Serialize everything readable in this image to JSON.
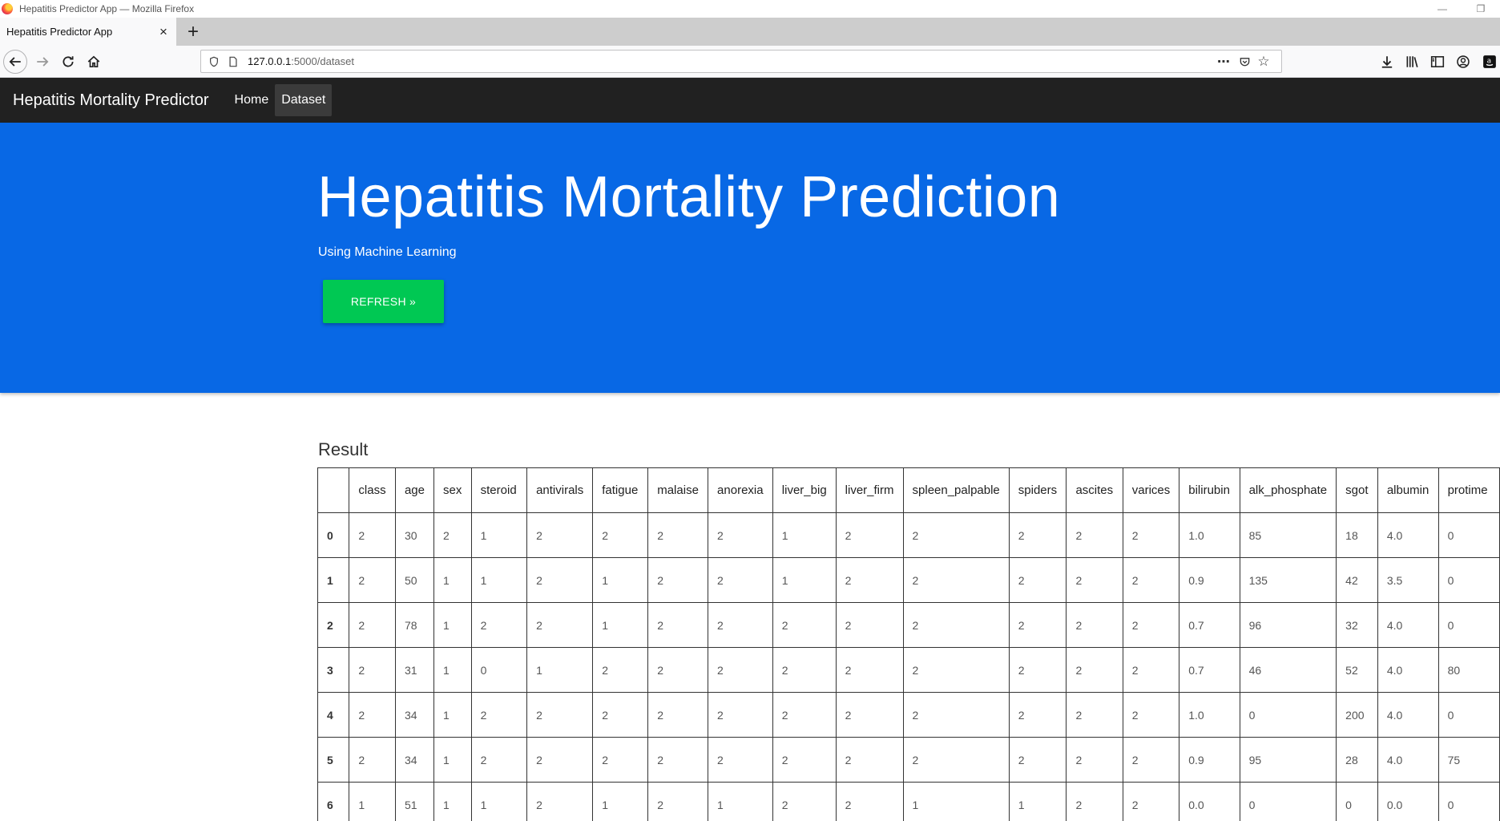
{
  "browser": {
    "window_title": "Hepatitis Predictor App — Mozilla Firefox",
    "tab_title": "Hepatitis Predictor App",
    "url_host": "127.0.0.1",
    "url_path": ":5000/dataset"
  },
  "nav": {
    "brand": "Hepatitis Mortality Predictor",
    "links": [
      "Home",
      "Dataset"
    ],
    "active": "Dataset"
  },
  "hero": {
    "title": "Hepatitis Mortality Prediction",
    "subtitle": "Using Machine Learning",
    "button_label": "REFRESH »",
    "background_color": "#0868e5",
    "button_color": "#00c853"
  },
  "result": {
    "title": "Result",
    "columns": [
      "",
      "class",
      "age",
      "sex",
      "steroid",
      "antivirals",
      "fatigue",
      "malaise",
      "anorexia",
      "liver_big",
      "liver_firm",
      "spleen_palpable",
      "spiders",
      "ascites",
      "varices",
      "bilirubin",
      "alk_phosphate",
      "sgot",
      "albumin",
      "protime"
    ],
    "rows": [
      [
        "0",
        "2",
        "30",
        "2",
        "1",
        "2",
        "2",
        "2",
        "2",
        "1",
        "2",
        "2",
        "2",
        "2",
        "2",
        "1.0",
        "85",
        "18",
        "4.0",
        "0"
      ],
      [
        "1",
        "2",
        "50",
        "1",
        "1",
        "2",
        "1",
        "2",
        "2",
        "1",
        "2",
        "2",
        "2",
        "2",
        "2",
        "0.9",
        "135",
        "42",
        "3.5",
        "0"
      ],
      [
        "2",
        "2",
        "78",
        "1",
        "2",
        "2",
        "1",
        "2",
        "2",
        "2",
        "2",
        "2",
        "2",
        "2",
        "2",
        "0.7",
        "96",
        "32",
        "4.0",
        "0"
      ],
      [
        "3",
        "2",
        "31",
        "1",
        "0",
        "1",
        "2",
        "2",
        "2",
        "2",
        "2",
        "2",
        "2",
        "2",
        "2",
        "0.7",
        "46",
        "52",
        "4.0",
        "80"
      ],
      [
        "4",
        "2",
        "34",
        "1",
        "2",
        "2",
        "2",
        "2",
        "2",
        "2",
        "2",
        "2",
        "2",
        "2",
        "2",
        "1.0",
        "0",
        "200",
        "4.0",
        "0"
      ],
      [
        "5",
        "2",
        "34",
        "1",
        "2",
        "2",
        "2",
        "2",
        "2",
        "2",
        "2",
        "2",
        "2",
        "2",
        "2",
        "0.9",
        "95",
        "28",
        "4.0",
        "75"
      ],
      [
        "6",
        "1",
        "51",
        "1",
        "1",
        "2",
        "1",
        "2",
        "1",
        "2",
        "2",
        "1",
        "1",
        "2",
        "2",
        "0.0",
        "0",
        "0",
        "0.0",
        "0"
      ]
    ]
  }
}
